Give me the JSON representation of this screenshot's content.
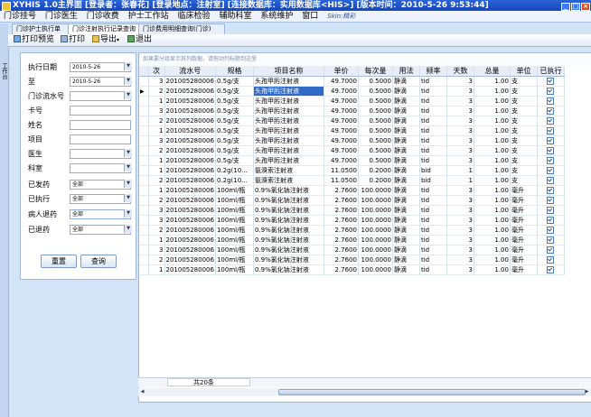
{
  "window": {
    "title": "XYHIS 1.0主界面  [登录者：张春花] [登录地点：注射室] [连接数据库：实用数据库<HIS>] [版本时间：2010-5-26 9:53:44]"
  },
  "menu": {
    "items": [
      "门诊挂号",
      "门诊医生",
      "门诊收费",
      "护士工作站",
      "临床检验",
      "辅助科室",
      "系统维护",
      "窗口"
    ],
    "skin": "Skin:精彩"
  },
  "side_strip": {
    "label": "工作台"
  },
  "tabs": [
    "门诊护士执行单",
    "门诊注射执行记录查询",
    "门诊费用明细查询(门诊)"
  ],
  "toolbar": {
    "preview": "打印预览",
    "print": "打印",
    "export": "导出",
    "exit": "退出"
  },
  "filters": {
    "exec_date": {
      "label": "执行日期",
      "value": "2010-5-26"
    },
    "to_date": {
      "label": "至",
      "value": "2010-5-26"
    },
    "serial": {
      "label": "门诊流水号",
      "value": ""
    },
    "card": {
      "label": "卡号",
      "value": ""
    },
    "name": {
      "label": "姓名",
      "value": ""
    },
    "item": {
      "label": "项目",
      "value": ""
    },
    "doctor": {
      "label": "医生",
      "value": ""
    },
    "dept": {
      "label": "科室",
      "value": ""
    },
    "dispensed": {
      "label": "已发药",
      "value": "全部"
    },
    "executed": {
      "label": "已执行",
      "value": "全部"
    },
    "returned_by_patient": {
      "label": "病人退药",
      "value": "全部"
    },
    "refunded": {
      "label": "已退药",
      "value": "全部"
    }
  },
  "buttons": {
    "reset": "重置",
    "query": "查询"
  },
  "grid": {
    "group_hint": "如果要分组显示其列数据，请拖动列标题到这里",
    "columns": [
      "次",
      "流水号",
      "规格",
      "项目名称",
      "单价",
      "每次量",
      "用法",
      "频率",
      "天数",
      "总量",
      "单位",
      "已执行"
    ],
    "rows": [
      [
        "3",
        "201005280006",
        "0.5g/支",
        "头孢甲肟注射液",
        "49.7000",
        "0.5000",
        "静滴",
        "tid",
        "3",
        "1.00",
        "支"
      ],
      [
        "2",
        "201005280006",
        "0.5g/支",
        "头孢甲肟注射液",
        "49.7000",
        "0.5000",
        "静滴",
        "tid",
        "3",
        "1.00",
        "支"
      ],
      [
        "1",
        "201005280006",
        "0.5g/支",
        "头孢甲肟注射液",
        "49.7000",
        "0.5000",
        "静滴",
        "tid",
        "3",
        "1.00",
        "支"
      ],
      [
        "3",
        "201005280006",
        "0.5g/支",
        "头孢甲肟注射液",
        "49.7000",
        "0.5000",
        "静滴",
        "tid",
        "3",
        "1.00",
        "支"
      ],
      [
        "2",
        "201005280006",
        "0.5g/支",
        "头孢甲肟注射液",
        "49.7000",
        "0.5000",
        "静滴",
        "tid",
        "3",
        "1.00",
        "支"
      ],
      [
        "1",
        "201005280006",
        "0.5g/支",
        "头孢甲肟注射液",
        "49.7000",
        "0.5000",
        "静滴",
        "tid",
        "3",
        "1.00",
        "支"
      ],
      [
        "3",
        "201005280006",
        "0.5g/支",
        "头孢甲肟注射液",
        "49.7000",
        "0.5000",
        "静滴",
        "tid",
        "3",
        "1.00",
        "支"
      ],
      [
        "2",
        "201005280006",
        "0.5g/支",
        "头孢甲肟注射液",
        "49.7000",
        "0.5000",
        "静滴",
        "tid",
        "3",
        "1.00",
        "支"
      ],
      [
        "1",
        "201005280006",
        "0.5g/支",
        "头孢甲肟注射液",
        "49.7000",
        "0.5000",
        "静滴",
        "tid",
        "3",
        "1.00",
        "支"
      ],
      [
        "1",
        "201005280006",
        "0.2g(10...",
        "氨溴索注射液",
        "11.0500",
        "0.2000",
        "静滴",
        "bid",
        "1",
        "1.00",
        "支"
      ],
      [
        "2",
        "201005280006",
        "0.2g(10...",
        "氨溴索注射液",
        "11.0500",
        "0.2000",
        "静滴",
        "bid",
        "1",
        "1.00",
        "支"
      ],
      [
        "1",
        "201005280006",
        "100ml/瓶",
        "0.9%氯化钠注射液",
        "2.7600",
        "100.0000",
        "静滴",
        "tid",
        "3",
        "1.00",
        "毫升"
      ],
      [
        "2",
        "201005280006",
        "100ml/瓶",
        "0.9%氯化钠注射液",
        "2.7600",
        "100.0000",
        "静滴",
        "tid",
        "3",
        "1.00",
        "毫升"
      ],
      [
        "3",
        "201005280006",
        "100ml/瓶",
        "0.9%氯化钠注射液",
        "2.7600",
        "100.0000",
        "静滴",
        "tid",
        "3",
        "1.00",
        "毫升"
      ],
      [
        "3",
        "201005280006",
        "100ml/瓶",
        "0.9%氯化钠注射液",
        "2.7600",
        "100.0000",
        "静滴",
        "tid",
        "3",
        "1.00",
        "毫升"
      ],
      [
        "2",
        "201005280006",
        "100ml/瓶",
        "0.9%氯化钠注射液",
        "2.7600",
        "100.0000",
        "静滴",
        "tid",
        "3",
        "1.00",
        "毫升"
      ],
      [
        "1",
        "201005280006",
        "100ml/瓶",
        "0.9%氯化钠注射液",
        "2.7600",
        "100.0000",
        "静滴",
        "tid",
        "3",
        "1.00",
        "毫升"
      ],
      [
        "3",
        "201005280006",
        "100ml/瓶",
        "0.9%氯化钠注射液",
        "2.7600",
        "100.0000",
        "静滴",
        "tid",
        "3",
        "1.00",
        "毫升"
      ],
      [
        "2",
        "201005280006",
        "100ml/瓶",
        "0.9%氯化钠注射液",
        "2.7600",
        "100.0000",
        "静滴",
        "tid",
        "3",
        "1.00",
        "毫升"
      ],
      [
        "1",
        "201005280006",
        "100ml/瓶",
        "0.9%氯化钠注射液",
        "2.7600",
        "100.0000",
        "静滴",
        "tid",
        "3",
        "1.00",
        "毫升"
      ]
    ],
    "footer_count": "共20条"
  }
}
